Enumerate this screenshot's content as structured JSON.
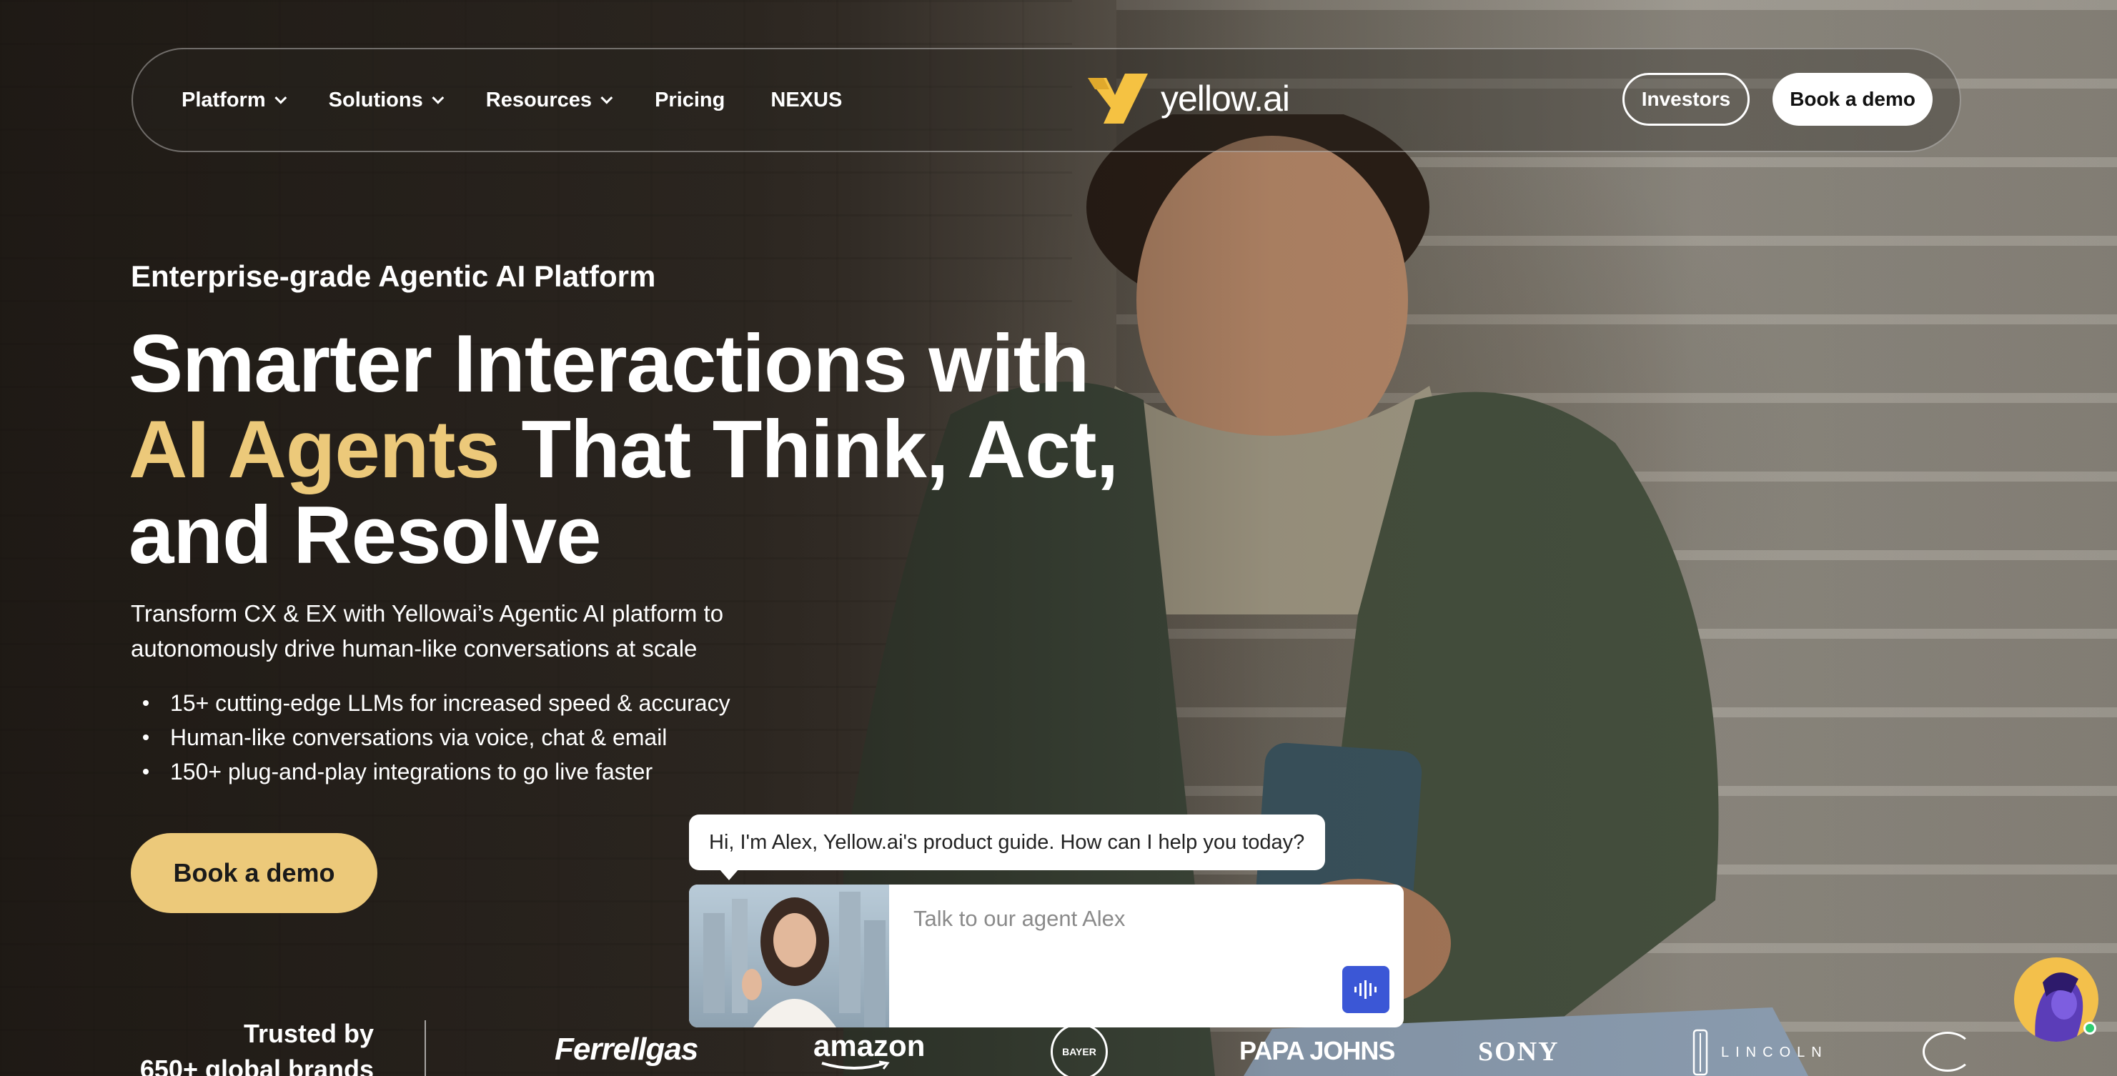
{
  "nav": {
    "items": [
      {
        "label": "Platform",
        "has_dropdown": true
      },
      {
        "label": "Solutions",
        "has_dropdown": true
      },
      {
        "label": "Resources",
        "has_dropdown": true
      },
      {
        "label": "Pricing",
        "has_dropdown": false
      },
      {
        "label": "NEXUS",
        "has_dropdown": false
      }
    ],
    "logo_text": "yellow.ai",
    "investors_label": "Investors",
    "book_demo_label": "Book a demo"
  },
  "hero": {
    "eyebrow": "Enterprise-grade Agentic AI Platform",
    "headline_line1": "Smarter Interactions with",
    "headline_accent": "AI Agents",
    "headline_line2_rest": " That Think, Act,",
    "headline_line3": "and Resolve",
    "subtext": "Transform CX & EX with Yellowai’s Agentic AI platform to autonomously drive human-like conversations at scale",
    "bullets": [
      "15+ cutting-edge LLMs for increased speed & accuracy",
      "Human-like conversations via voice, chat & email",
      "150+ plug-and-play integrations to go live faster"
    ],
    "cta_label": "Book a demo"
  },
  "chat": {
    "greeting": "Hi, I'm Alex, Yellow.ai's product guide. How can I help you today?",
    "input_placeholder": "Talk to our agent Alex"
  },
  "trusted": {
    "line1": "Trusted by",
    "line2": "650+ global brands",
    "brands": [
      "Ferrellgas",
      "amazon",
      "BAYER",
      "PAPA JOHNS",
      "SONY",
      "LINCOLN"
    ]
  },
  "colors": {
    "accent": "#ecc97a",
    "logo_yellow": "#f5c242",
    "mic_blue": "#3b57d6"
  }
}
